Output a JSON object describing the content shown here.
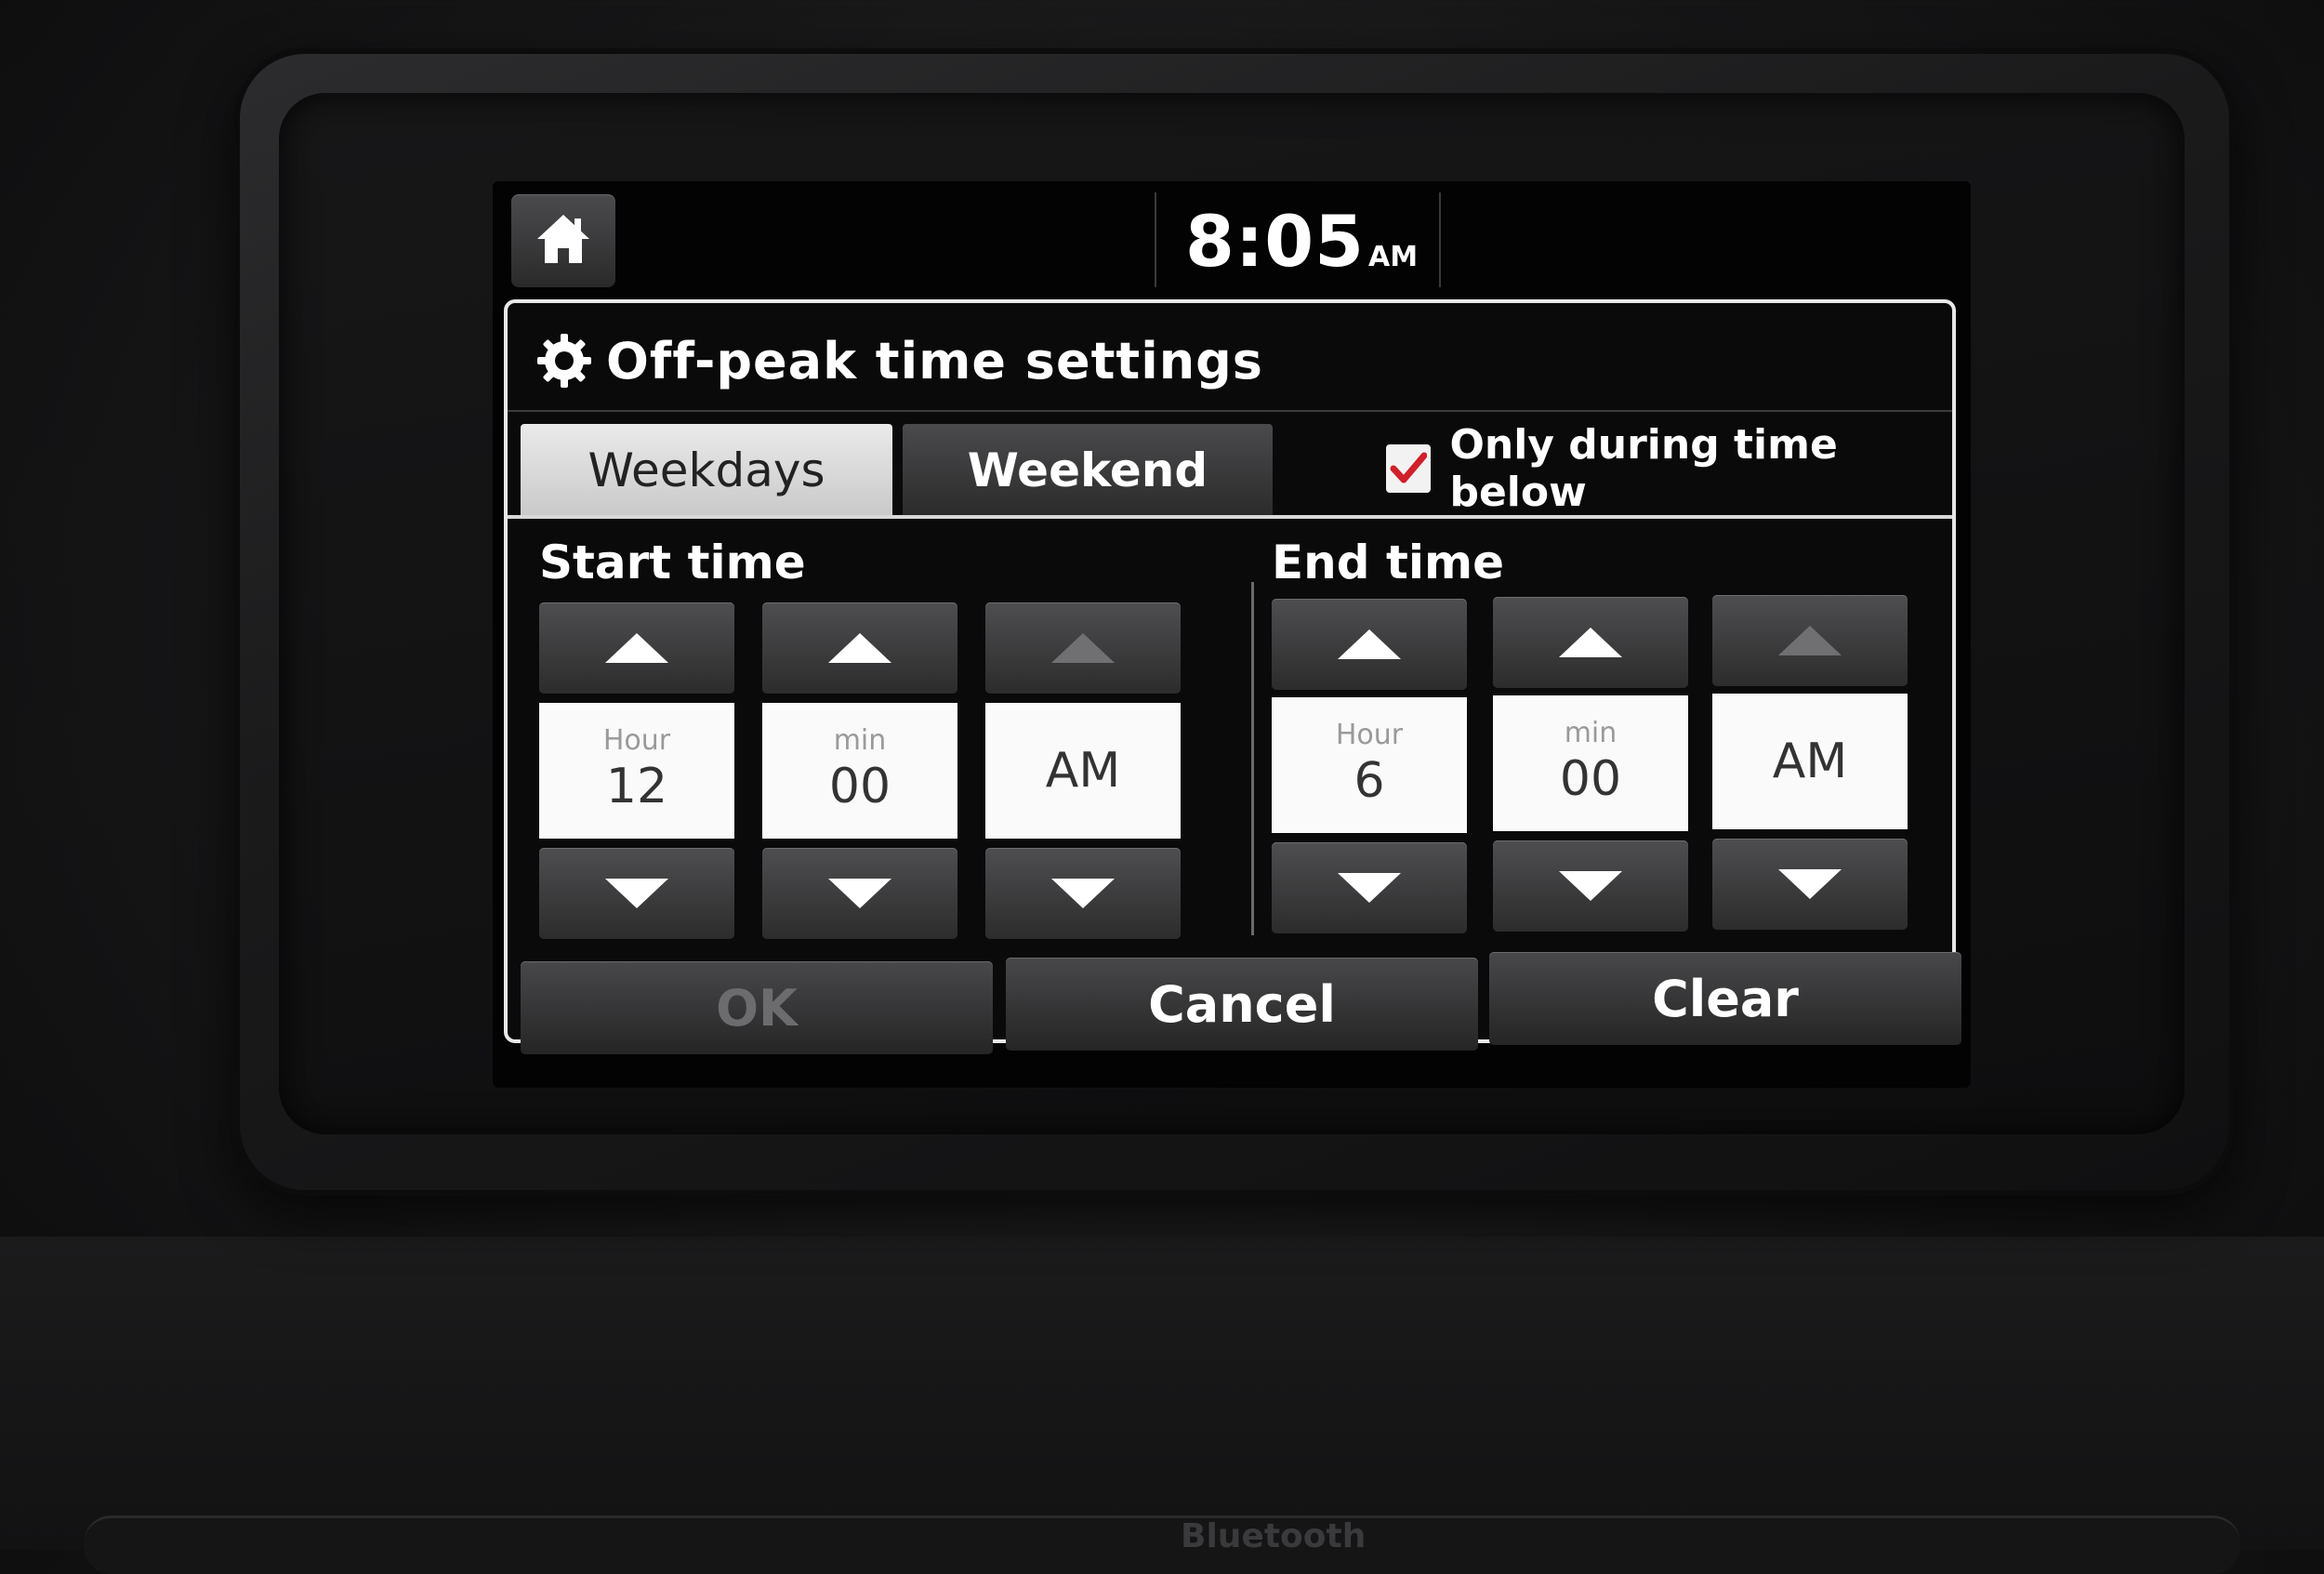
{
  "status_bar": {
    "time": "8:05",
    "ampm": "AM"
  },
  "dialog": {
    "title": "Off-peak time settings",
    "tabs": [
      {
        "label": "Weekdays",
        "selected": true
      },
      {
        "label": "Weekend",
        "selected": false
      }
    ],
    "only_during": {
      "label": "Only during time below",
      "checked": true
    },
    "start_time": {
      "label": "Start time",
      "hour_caption": "Hour",
      "hour": "12",
      "min_caption": "min",
      "min": "00",
      "ampm": "AM"
    },
    "end_time": {
      "label": "End time",
      "hour_caption": "Hour",
      "hour": "6",
      "min_caption": "min",
      "min": "00",
      "ampm": "AM"
    },
    "buttons": {
      "ok": "OK",
      "cancel": "Cancel",
      "clear": "Clear"
    }
  },
  "icons": [
    "home-icon",
    "gear-icon",
    "checkmark-icon",
    "arrow-up-icon",
    "arrow-down-icon"
  ],
  "colors": {
    "check_accent": "#d0202a",
    "screen_bg": "#030303",
    "value_box": "#fafafa"
  },
  "hardware": {
    "bluetooth_label": "Bluetooth"
  }
}
